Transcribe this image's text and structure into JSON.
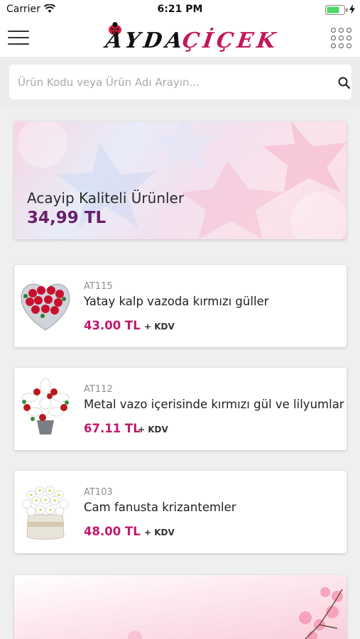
{
  "status_bar": {
    "carrier": "Carrier",
    "time": "6:21 PM"
  },
  "header": {
    "logo_part1": "AYDA",
    "logo_part2": "ÇİÇEK"
  },
  "search": {
    "placeholder": "Ürün Kodu veya Ürün Adı Arayın..."
  },
  "banners": [
    {
      "title": "Acayip Kaliteli Ürünler",
      "price": "34,99 TL"
    }
  ],
  "products": [
    {
      "code": "AT115",
      "name": "Yatay kalp vazoda kırmızı güller",
      "price": "43.00 TL",
      "tax": "+ KDV",
      "image": "red-roses-heart-vase"
    },
    {
      "code": "AT112",
      "name": "Metal vazo içerisinde kırmızı gül ve lilyumlar",
      "price": "67.11 TL",
      "tax": "+ KDV",
      "image": "red-roses-white-lilies"
    },
    {
      "code": "AT103",
      "name": "Cam fanusta krizantemler",
      "price": "48.00 TL",
      "tax": "+ KDV",
      "image": "white-chrysanthemums-glass"
    }
  ],
  "colors": {
    "accent": "#c2186e",
    "banner_price": "#6a1f6a",
    "background": "#efefef"
  }
}
